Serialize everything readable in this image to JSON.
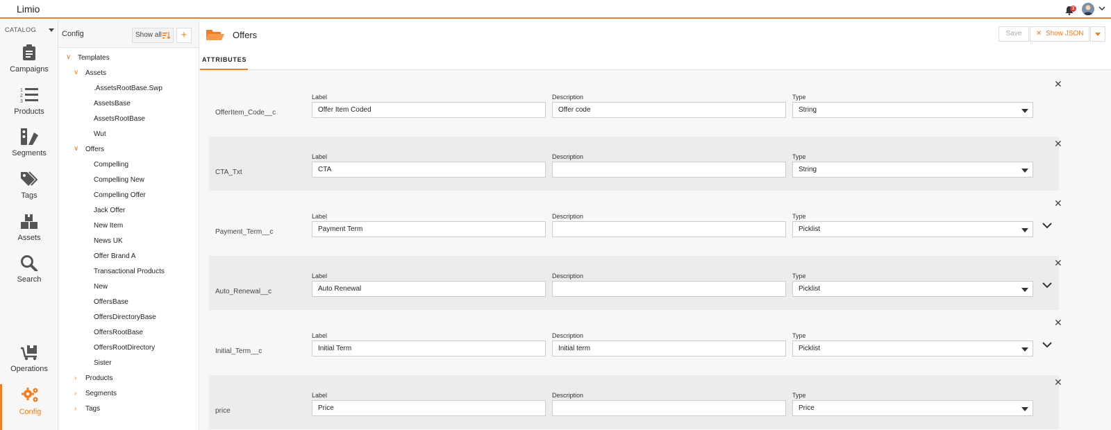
{
  "app": {
    "name": "Limio",
    "notification_count": "3"
  },
  "leftnav": {
    "catalog_label": "CATALOG",
    "items": [
      {
        "label": "Campaigns",
        "icon": "clipboard-icon"
      },
      {
        "label": "Products",
        "icon": "numbered-list-icon"
      },
      {
        "label": "Segments",
        "icon": "segments-icon"
      },
      {
        "label": "Tags",
        "icon": "tags-icon"
      },
      {
        "label": "Assets",
        "icon": "assets-icon"
      },
      {
        "label": "Search",
        "icon": "search-icon"
      },
      {
        "label": "Operations",
        "icon": "operations-icon"
      },
      {
        "label": "Config",
        "icon": "gears-icon",
        "active": true
      }
    ]
  },
  "tree": {
    "title": "Config",
    "show_all_label": "Show all",
    "add_label": "+",
    "nodes": [
      {
        "label": "Templates",
        "expanded": true
      },
      {
        "label": "Assets",
        "expanded": true
      },
      {
        "label": ".AssetsRootBase.Swp"
      },
      {
        "label": "AssetsBase"
      },
      {
        "label": "AssetsRootBase"
      },
      {
        "label": "Wut"
      },
      {
        "label": "Offers",
        "expanded": true
      },
      {
        "label": "Compelling"
      },
      {
        "label": "Compelling New"
      },
      {
        "label": "Compelling Offer"
      },
      {
        "label": "Jack Offer"
      },
      {
        "label": "New Item"
      },
      {
        "label": "News UK"
      },
      {
        "label": "Offer Brand A"
      },
      {
        "label": "Transactional Products"
      },
      {
        "label": "New"
      },
      {
        "label": "OffersBase"
      },
      {
        "label": "OffersDirectoryBase"
      },
      {
        "label": "OffersRootBase"
      },
      {
        "label": "OffersRootDirectory"
      },
      {
        "label": "Sister"
      },
      {
        "label": "Products",
        "expanded": false
      },
      {
        "label": "Segments",
        "expanded": false
      },
      {
        "label": "Tags",
        "expanded": false
      }
    ]
  },
  "main": {
    "title": "Offers",
    "save_label": "Save",
    "show_json_label": "Show JSON",
    "tab_label": "ATTRIBUTES",
    "field_labels": {
      "label": "Label",
      "description": "Description",
      "type": "Type"
    },
    "attributes": [
      {
        "name": "OfferItem_Code__c",
        "label": "Offer Item Coded",
        "description": "Offer code",
        "type": "String",
        "expandable": false
      },
      {
        "name": "CTA_Txt",
        "label": "CTA",
        "description": "",
        "type": "String",
        "expandable": false
      },
      {
        "name": "Payment_Term__c",
        "label": "Payment Term",
        "description": "",
        "type": "Picklist",
        "expandable": true
      },
      {
        "name": "Auto_Renewal__c",
        "label": "Auto Renewal",
        "description": "",
        "type": "Picklist",
        "expandable": true
      },
      {
        "name": "Initial_Term__c",
        "label": "Initial Term",
        "description": "Initial term",
        "type": "Picklist",
        "expandable": true
      },
      {
        "name": "price",
        "label": "Price",
        "description": "",
        "type": "Price",
        "expandable": false
      }
    ]
  }
}
